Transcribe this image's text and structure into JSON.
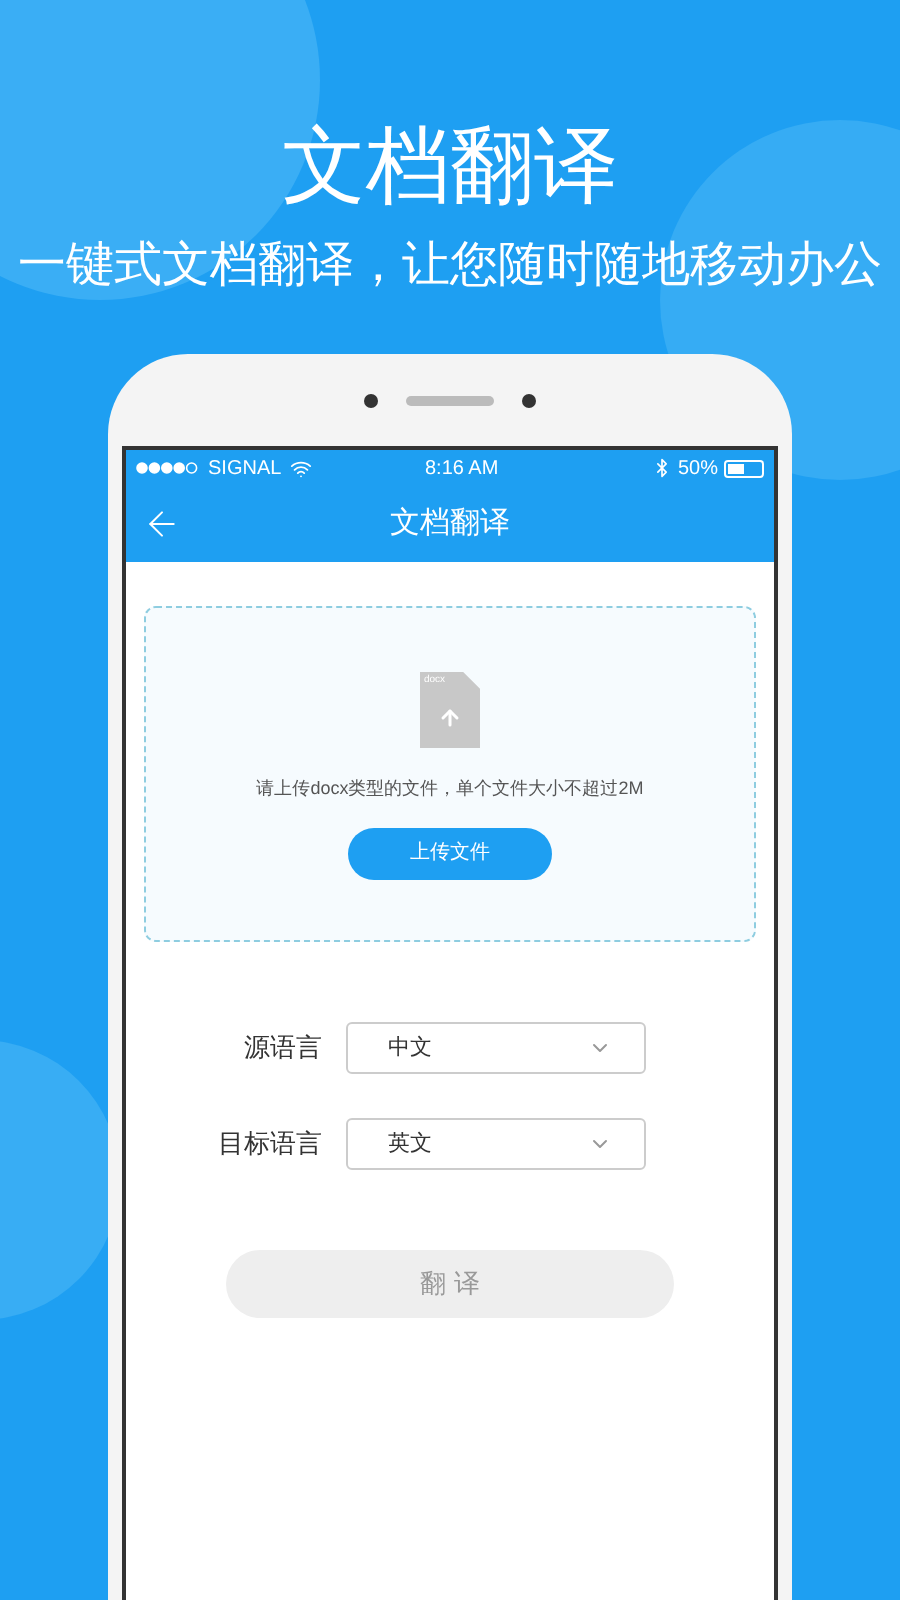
{
  "headline": "文档翻译",
  "tagline": "一键式文档翻译，让您随时随地移动办公",
  "status_bar": {
    "carrier": "SIGNAL",
    "time": "8:16 AM",
    "battery": "50%"
  },
  "nav": {
    "title": "文档翻译"
  },
  "upload": {
    "file_type": "docx",
    "hint": "请上传docx类型的文件，单个文件大小不超过2M",
    "button": "上传文件"
  },
  "languages": [
    {
      "label": "源语言",
      "value": "中文"
    },
    {
      "label": "目标语言",
      "value": "英文"
    }
  ],
  "translate_button": {
    "label": "翻 译",
    "disabled": true
  }
}
